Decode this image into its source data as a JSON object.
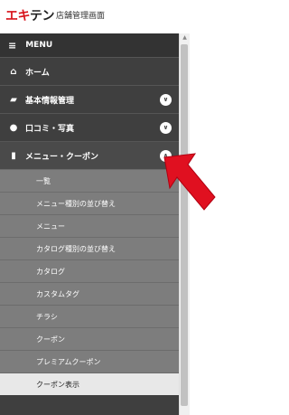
{
  "header": {
    "logo_mark": "エキ",
    "logo_rest": "テン",
    "title": "店舗管理画面"
  },
  "menu": {
    "label": "MENU"
  },
  "nav": [
    {
      "label": "ホーム",
      "icon": "home-icon",
      "chevron": ""
    },
    {
      "label": "基本情報管理",
      "icon": "folder-icon",
      "chevron": "down"
    },
    {
      "label": "口コミ・写真",
      "icon": "comments-icon",
      "chevron": "down"
    },
    {
      "label": "メニュー・クーポン",
      "icon": "bookmark-icon",
      "chevron": "up"
    }
  ],
  "submenu": [
    "一覧",
    "メニュー種別の並び替え",
    "メニュー",
    "カタログ種別の並び替え",
    "カタログ",
    "カスタムタグ",
    "チラシ",
    "クーポン",
    "プレミアムクーポン",
    "クーポン表示"
  ],
  "colors": {
    "accent_arrow": "#e01020",
    "sidebar_bg": "#3f3f3f",
    "submenu_bg": "#7d7d7d"
  }
}
